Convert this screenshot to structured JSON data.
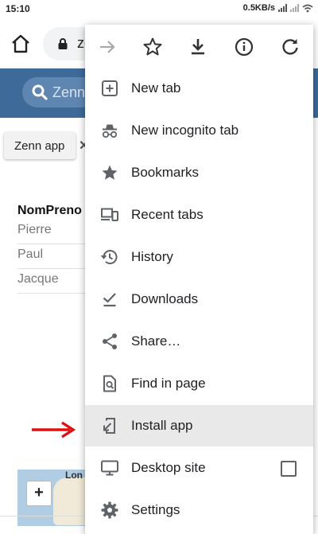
{
  "status_bar": {
    "time": "15:10",
    "net_speed": "0.5KB/s"
  },
  "browser": {
    "url": "ze"
  },
  "page": {
    "search_placeholder": "Zenn",
    "chip_label": "Zenn app",
    "chip_close": "✕",
    "table": {
      "header": "NomPreno",
      "rows": [
        "Pierre",
        "Paul",
        "Jacque"
      ]
    },
    "map_label": "Lon",
    "map_zoom": "+"
  },
  "menu": {
    "icon_bar": [
      "forward-icon",
      "bookmark-star-icon",
      "download-icon",
      "info-icon",
      "refresh-icon"
    ],
    "items": [
      {
        "label": "New tab",
        "icon": "new-tab-icon"
      },
      {
        "label": "New incognito tab",
        "icon": "incognito-icon"
      },
      {
        "label": "Bookmarks",
        "icon": "star-icon"
      },
      {
        "label": "Recent tabs",
        "icon": "recent-tabs-icon"
      },
      {
        "label": "History",
        "icon": "history-icon"
      },
      {
        "label": "Downloads",
        "icon": "downloads-icon"
      },
      {
        "label": "Share…",
        "icon": "share-icon"
      },
      {
        "label": "Find in page",
        "icon": "find-in-page-icon"
      },
      {
        "label": "Install app",
        "icon": "install-app-icon",
        "highlighted": true
      },
      {
        "label": "Desktop site",
        "icon": "desktop-icon",
        "checkbox": false
      },
      {
        "label": "Settings",
        "icon": "settings-icon"
      }
    ]
  },
  "colors": {
    "site_header": "#3d6a99",
    "menu_highlight": "#e9e9e9",
    "arrow": "#e01010"
  }
}
